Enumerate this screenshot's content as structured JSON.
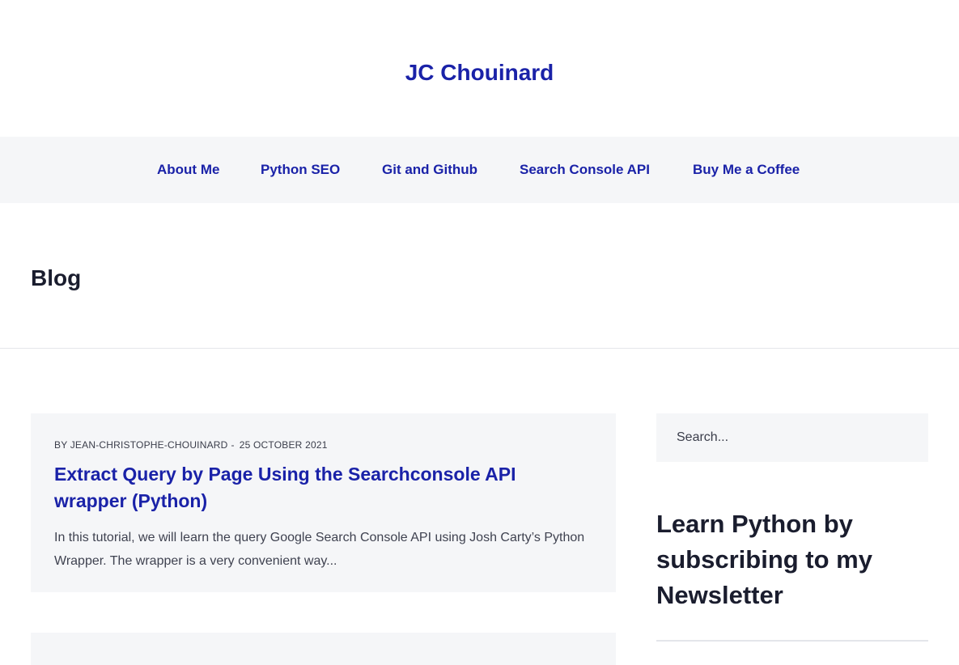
{
  "site": {
    "title": "JC Chouinard"
  },
  "nav": {
    "items": [
      {
        "label": "About Me"
      },
      {
        "label": "Python SEO"
      },
      {
        "label": "Git and Github"
      },
      {
        "label": "Search Console API"
      },
      {
        "label": "Buy Me a Coffee"
      }
    ]
  },
  "page": {
    "title": "Blog"
  },
  "posts": [
    {
      "author_label": "BY JEAN-CHRISTOPHE-CHOUINARD",
      "separator": "-",
      "date": "25 OCTOBER 2021",
      "title": "Extract Query by Page Using the Searchconsole API wrapper (Python)",
      "excerpt": "In this tutorial, we will learn the query Google Search Console API using Josh Carty’s Python Wrapper. The wrapper is a very convenient way..."
    }
  ],
  "sidebar": {
    "search_placeholder": "Search...",
    "widget_title": "Learn Python by subscribing to my Newsletter"
  },
  "colors": {
    "link": "#1a22a8",
    "text": "#1a1d2e",
    "panel": "#f5f6f8"
  }
}
